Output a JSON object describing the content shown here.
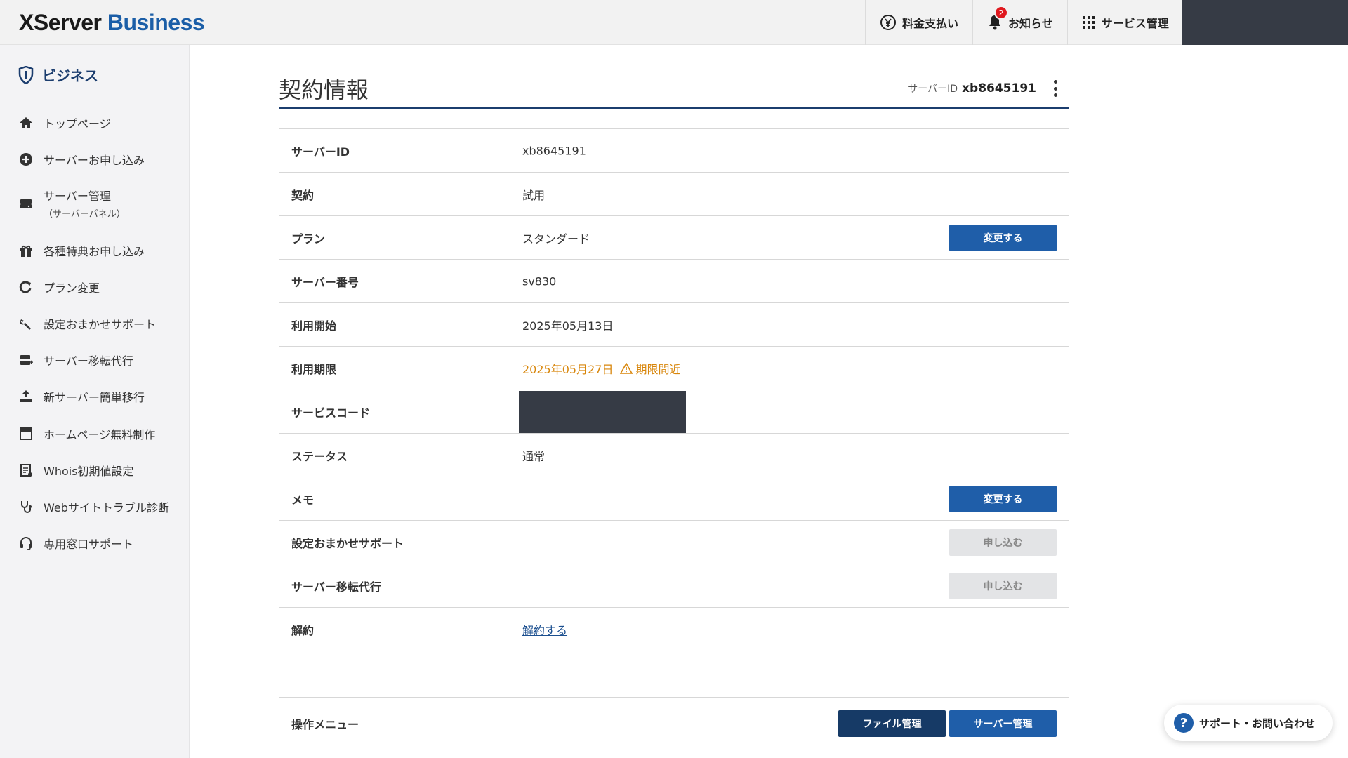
{
  "header": {
    "logo_part1": "XServer",
    "logo_part2": "Business",
    "nav": {
      "payment": "料金支払い",
      "notice": "お知らせ",
      "notice_badge": "2",
      "service": "サービス管理"
    }
  },
  "sidebar": {
    "title": "ビジネス",
    "items": [
      {
        "label": "トップページ",
        "icon": "home-icon"
      },
      {
        "label": "サーバーお申し込み",
        "icon": "plus-circle-icon"
      },
      {
        "label": "サーバー管理",
        "sub": "（サーバーパネル）",
        "icon": "server-icon"
      },
      {
        "label": "各種特典お申し込み",
        "icon": "gift-icon"
      },
      {
        "label": "プラン変更",
        "icon": "refresh-icon"
      },
      {
        "label": "設定おまかせサポート",
        "icon": "wrench-icon"
      },
      {
        "label": "サーバー移転代行",
        "icon": "server-move-icon"
      },
      {
        "label": "新サーバー簡単移行",
        "icon": "upload-icon"
      },
      {
        "label": "ホームページ無料制作",
        "icon": "browser-icon"
      },
      {
        "label": "Whois初期値設定",
        "icon": "document-icon"
      },
      {
        "label": "Webサイトトラブル診断",
        "icon": "stethoscope-icon"
      },
      {
        "label": "専用窓口サポート",
        "icon": "headset-icon"
      }
    ]
  },
  "main": {
    "title": "契約情報",
    "server_id_label": "サーバーID",
    "server_id_value": "xb8645191",
    "rows": {
      "server_id": {
        "key": "サーバーID",
        "value": "xb8645191"
      },
      "contract": {
        "key": "契約",
        "value": "試用"
      },
      "plan": {
        "key": "プラン",
        "value": "スタンダード",
        "button": "変更する"
      },
      "server_no": {
        "key": "サーバー番号",
        "value": "sv830"
      },
      "start": {
        "key": "利用開始",
        "value": "2025年05月13日"
      },
      "expiry": {
        "key": "利用期限",
        "value": "2025年05月27日",
        "warning": "期限間近"
      },
      "service_code": {
        "key": "サービスコード"
      },
      "status": {
        "key": "ステータス",
        "value": "通常"
      },
      "memo": {
        "key": "メモ",
        "button": "変更する"
      },
      "setup_support": {
        "key": "設定おまかせサポート",
        "button": "申し込む"
      },
      "migration": {
        "key": "サーバー移転代行",
        "button": "申し込む"
      },
      "cancel": {
        "key": "解約",
        "link": "解約する"
      }
    },
    "ops": {
      "key": "操作メニュー",
      "file_button": "ファイル管理",
      "server_button": "サーバー管理"
    }
  },
  "support_fab": "サポート・お問い合わせ",
  "colors": {
    "brand_blue": "#1f5ea9",
    "dark_navy": "#163a66",
    "warning": "#d8860b",
    "badge_red": "#e0191f"
  }
}
